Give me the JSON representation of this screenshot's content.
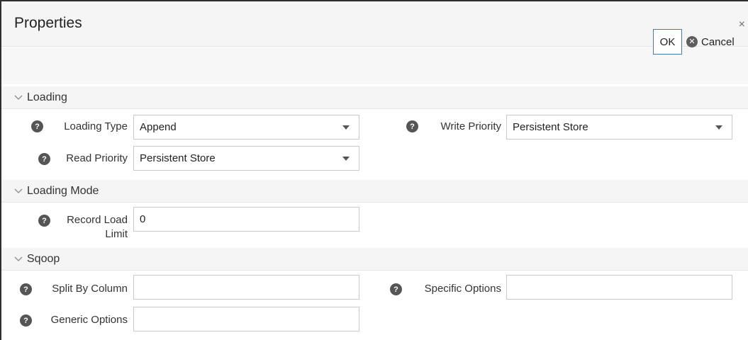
{
  "dialog": {
    "title": "Properties",
    "close_glyph": "×"
  },
  "toolbar": {
    "ok_label": "OK",
    "cancel_label": "Cancel",
    "cancel_icon": "x-circle-icon"
  },
  "sections": {
    "loading": {
      "title": "Loading",
      "loading_type": {
        "label": "Loading Type",
        "value": "Append"
      },
      "write_priority": {
        "label": "Write Priority",
        "value": "Persistent Store"
      },
      "read_priority": {
        "label": "Read Priority",
        "value": "Persistent Store"
      }
    },
    "loading_mode": {
      "title": "Loading Mode",
      "record_load_limit": {
        "label_line1": "Record Load",
        "label_line2": "Limit",
        "value": "0"
      }
    },
    "sqoop": {
      "title": "Sqoop",
      "split_by_column": {
        "label": "Split By Column",
        "value": ""
      },
      "specific_options": {
        "label": "Specific Options",
        "value": ""
      },
      "generic_options": {
        "label": "Generic Options",
        "value": ""
      }
    }
  },
  "icons": {
    "help": "?",
    "help_name": "help-icon",
    "chevron_name": "chevron-down-icon"
  },
  "colors": {
    "ok_border": "#4a78b4",
    "help_bg": "#555555",
    "header_bg": "#f5f5f5"
  }
}
